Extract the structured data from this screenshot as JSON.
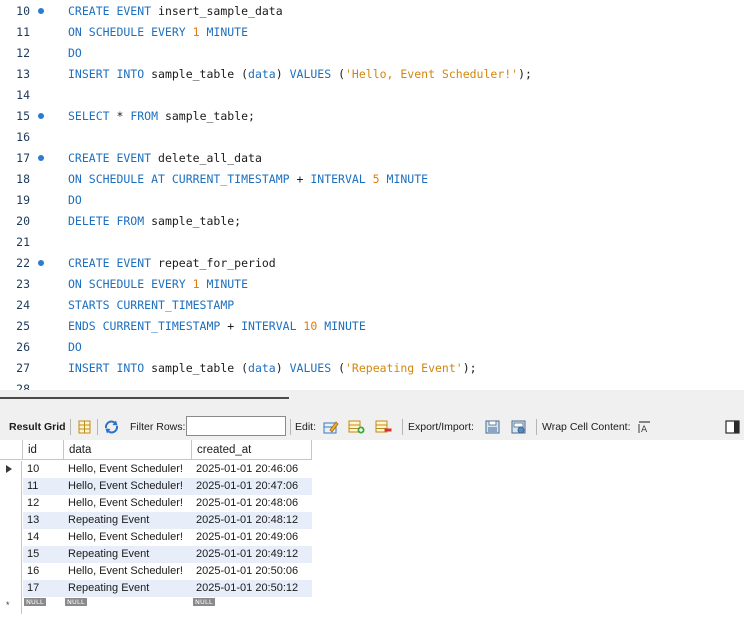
{
  "editor": {
    "lines": [
      {
        "no": "10",
        "dot": true,
        "tokens": [
          [
            "kw",
            "CREATE EVENT "
          ],
          [
            "ident",
            "insert_sample_data"
          ]
        ]
      },
      {
        "no": "11",
        "dot": false,
        "tokens": [
          [
            "kw",
            "ON SCHEDULE EVERY "
          ],
          [
            "num",
            "1"
          ],
          [
            "kw",
            " MINUTE"
          ]
        ]
      },
      {
        "no": "12",
        "dot": false,
        "tokens": [
          [
            "kw",
            "DO"
          ]
        ]
      },
      {
        "no": "13",
        "dot": false,
        "tokens": [
          [
            "kw",
            "INSERT INTO "
          ],
          [
            "ident",
            "sample_table ("
          ],
          [
            "kw",
            "data"
          ],
          [
            "ident",
            ") "
          ],
          [
            "kw",
            "VALUES "
          ],
          [
            "ident",
            "("
          ],
          [
            "str",
            "'Hello, Event Scheduler!'"
          ],
          [
            "ident",
            ");"
          ]
        ]
      },
      {
        "no": "14",
        "dot": false,
        "tokens": []
      },
      {
        "no": "15",
        "dot": true,
        "tokens": [
          [
            "kw",
            "SELECT "
          ],
          [
            "ident",
            "* "
          ],
          [
            "kw",
            "FROM "
          ],
          [
            "ident",
            "sample_table;"
          ]
        ]
      },
      {
        "no": "16",
        "dot": false,
        "tokens": []
      },
      {
        "no": "17",
        "dot": true,
        "tokens": [
          [
            "kw",
            "CREATE EVENT "
          ],
          [
            "ident",
            "delete_all_data"
          ]
        ]
      },
      {
        "no": "18",
        "dot": false,
        "tokens": [
          [
            "kw",
            "ON SCHEDULE AT CURRENT_TIMESTAMP "
          ],
          [
            "ident",
            "+ "
          ],
          [
            "kw",
            "INTERVAL "
          ],
          [
            "num",
            "5"
          ],
          [
            "kw",
            " MINUTE"
          ]
        ]
      },
      {
        "no": "19",
        "dot": false,
        "tokens": [
          [
            "kw",
            "DO"
          ]
        ]
      },
      {
        "no": "20",
        "dot": false,
        "tokens": [
          [
            "kw",
            "DELETE FROM "
          ],
          [
            "ident",
            "sample_table;"
          ]
        ]
      },
      {
        "no": "21",
        "dot": false,
        "tokens": []
      },
      {
        "no": "22",
        "dot": true,
        "tokens": [
          [
            "kw",
            "CREATE EVENT "
          ],
          [
            "ident",
            "repeat_for_period"
          ]
        ]
      },
      {
        "no": "23",
        "dot": false,
        "tokens": [
          [
            "kw",
            "ON SCHEDULE EVERY "
          ],
          [
            "num",
            "1"
          ],
          [
            "kw",
            " MINUTE"
          ]
        ]
      },
      {
        "no": "24",
        "dot": false,
        "tokens": [
          [
            "kw",
            "STARTS CURRENT_TIMESTAMP"
          ]
        ]
      },
      {
        "no": "25",
        "dot": false,
        "tokens": [
          [
            "kw",
            "ENDS CURRENT_TIMESTAMP "
          ],
          [
            "ident",
            "+ "
          ],
          [
            "kw",
            "INTERVAL "
          ],
          [
            "num",
            "10"
          ],
          [
            "kw",
            " MINUTE"
          ]
        ]
      },
      {
        "no": "26",
        "dot": false,
        "tokens": [
          [
            "kw",
            "DO"
          ]
        ]
      },
      {
        "no": "27",
        "dot": false,
        "tokens": [
          [
            "kw",
            "INSERT INTO "
          ],
          [
            "ident",
            "sample_table ("
          ],
          [
            "kw",
            "data"
          ],
          [
            "ident",
            ") "
          ],
          [
            "kw",
            "VALUES "
          ],
          [
            "ident",
            "("
          ],
          [
            "str",
            "'Repeating Event'"
          ],
          [
            "ident",
            ");"
          ]
        ]
      },
      {
        "no": "28",
        "dot": false,
        "tokens": []
      }
    ]
  },
  "toolbar": {
    "result_grid": "Result Grid",
    "filter_rows": "Filter Rows:",
    "filter_value": "",
    "edit": "Edit:",
    "export_import": "Export/Import:",
    "wrap_cell": "Wrap Cell Content:"
  },
  "grid": {
    "columns": [
      "id",
      "data",
      "created_at"
    ],
    "rows": [
      [
        "10",
        "Hello, Event Scheduler!",
        "2025-01-01 20:46:06"
      ],
      [
        "11",
        "Hello, Event Scheduler!",
        "2025-01-01 20:47:06"
      ],
      [
        "12",
        "Hello, Event Scheduler!",
        "2025-01-01 20:48:06"
      ],
      [
        "13",
        "Repeating Event",
        "2025-01-01 20:48:12"
      ],
      [
        "14",
        "Hello, Event Scheduler!",
        "2025-01-01 20:49:06"
      ],
      [
        "15",
        "Repeating Event",
        "2025-01-01 20:49:12"
      ],
      [
        "16",
        "Hello, Event Scheduler!",
        "2025-01-01 20:50:06"
      ],
      [
        "17",
        "Repeating Event",
        "2025-01-01 20:50:12"
      ]
    ],
    "null_label": "NULL",
    "new_row_marker": "*"
  },
  "colors": {
    "keyword": "#1d6fbf",
    "number": "#e07b10",
    "string": "#d4860b",
    "row_alt": "#e8eef9"
  }
}
